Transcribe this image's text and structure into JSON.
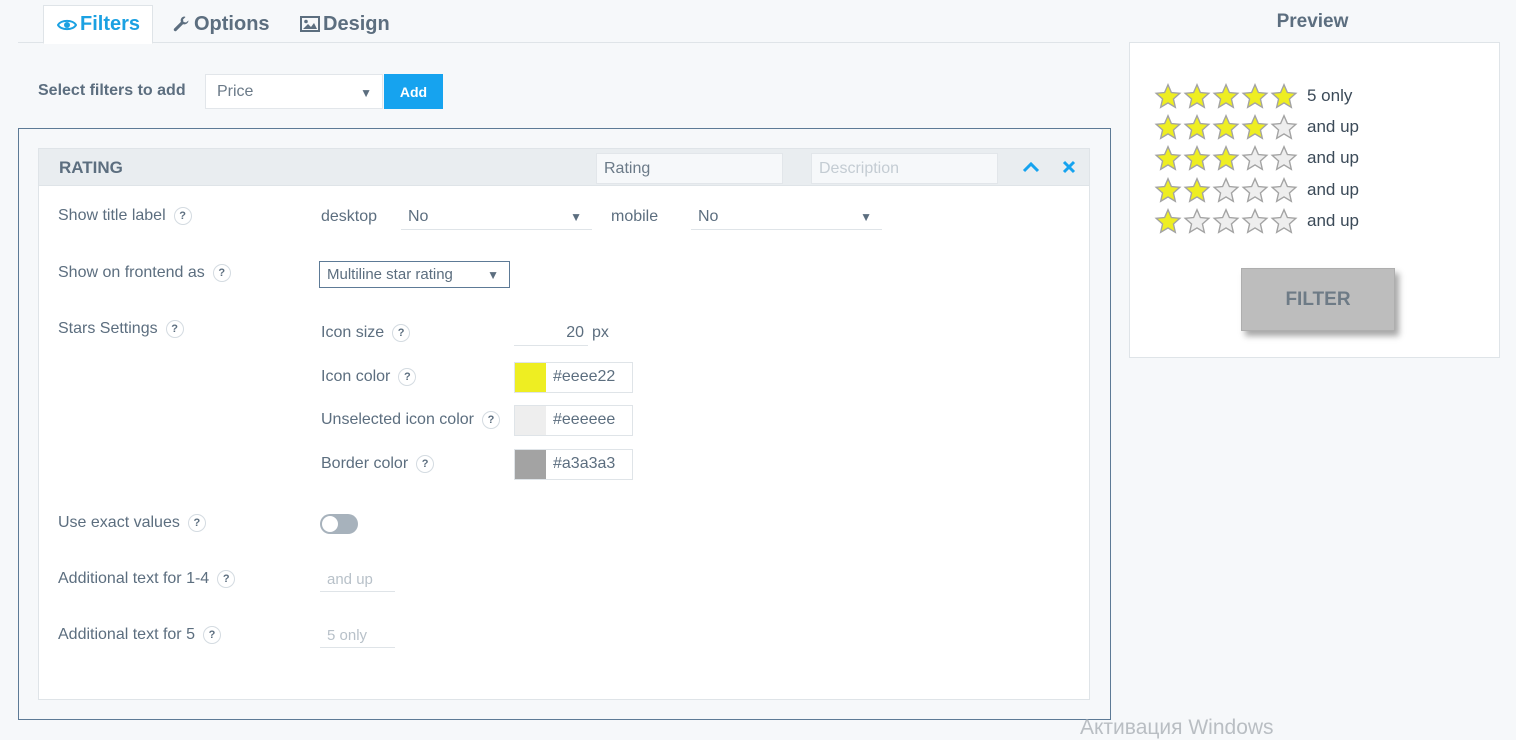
{
  "tabs": [
    {
      "label": "Filters",
      "icon": "eye-icon",
      "active": true
    },
    {
      "label": "Options",
      "icon": "wrench-icon",
      "active": false
    },
    {
      "label": "Design",
      "icon": "image-icon",
      "active": false
    }
  ],
  "add_filter": {
    "label": "Select filters to add",
    "selected": "Price",
    "button": "Add"
  },
  "rating_block": {
    "heading": "RATING",
    "title_value": "Rating",
    "description_placeholder": "Description",
    "help_mark": "?",
    "show_title_label": {
      "label": "Show title label",
      "desktop_label": "desktop",
      "desktop_value": "No",
      "mobile_label": "mobile",
      "mobile_value": "No"
    },
    "show_on_frontend": {
      "label": "Show on frontend as",
      "value": "Multiline star rating"
    },
    "stars_settings": {
      "label": "Stars Settings",
      "icon_size_label": "Icon size",
      "icon_size_value": "20",
      "icon_size_unit": "px",
      "icon_color_label": "Icon color",
      "icon_color_value": "#eeee22",
      "unselected_color_label": "Unselected icon color",
      "unselected_color_value": "#eeeeee",
      "border_color_label": "Border color",
      "border_color_value": "#a3a3a3"
    },
    "use_exact_values": {
      "label": "Use exact values",
      "on": false
    },
    "additional_text_1_4": {
      "label": "Additional text for 1-4",
      "placeholder": "and up"
    },
    "additional_text_5": {
      "label": "Additional text for 5",
      "placeholder": "5 only"
    }
  },
  "preview": {
    "title": "Preview",
    "rows": [
      {
        "stars": 5,
        "text": "5 only"
      },
      {
        "stars": 4,
        "text": "and up"
      },
      {
        "stars": 3,
        "text": "and up"
      },
      {
        "stars": 2,
        "text": "and up"
      },
      {
        "stars": 1,
        "text": "and up"
      }
    ],
    "button": "FILTER"
  },
  "colors": {
    "accent": "#16a3ef",
    "star_fill": "#eeee22",
    "star_empty": "#eeeeee",
    "star_border": "#a3a3a3"
  },
  "watermark": "Активация Windows"
}
